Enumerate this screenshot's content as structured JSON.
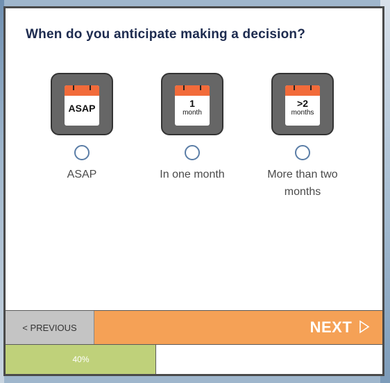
{
  "question": "When do you anticipate making a decision?",
  "options": [
    {
      "label": "ASAP",
      "icon": "calendar-asap-icon",
      "cal_line1": "ASAP",
      "cal_line2": "",
      "selected": false
    },
    {
      "label": "In one month",
      "icon": "calendar-one-month-icon",
      "cal_line1": "1",
      "cal_line2": "month",
      "selected": false
    },
    {
      "label": "More than two months",
      "icon": "calendar-two-plus-months-icon",
      "cal_line1": ">2",
      "cal_line2": "months",
      "selected": false
    }
  ],
  "nav": {
    "previous_label": "< PREVIOUS",
    "next_label": "NEXT"
  },
  "progress": {
    "value": 0.4,
    "text": "40%"
  },
  "colors": {
    "accent_orange": "#f5a156",
    "calendar_header": "#f26b3a",
    "progress_green": "#bfd17a",
    "radio_blue": "#5a7da6",
    "title_navy": "#1d2b4f"
  }
}
